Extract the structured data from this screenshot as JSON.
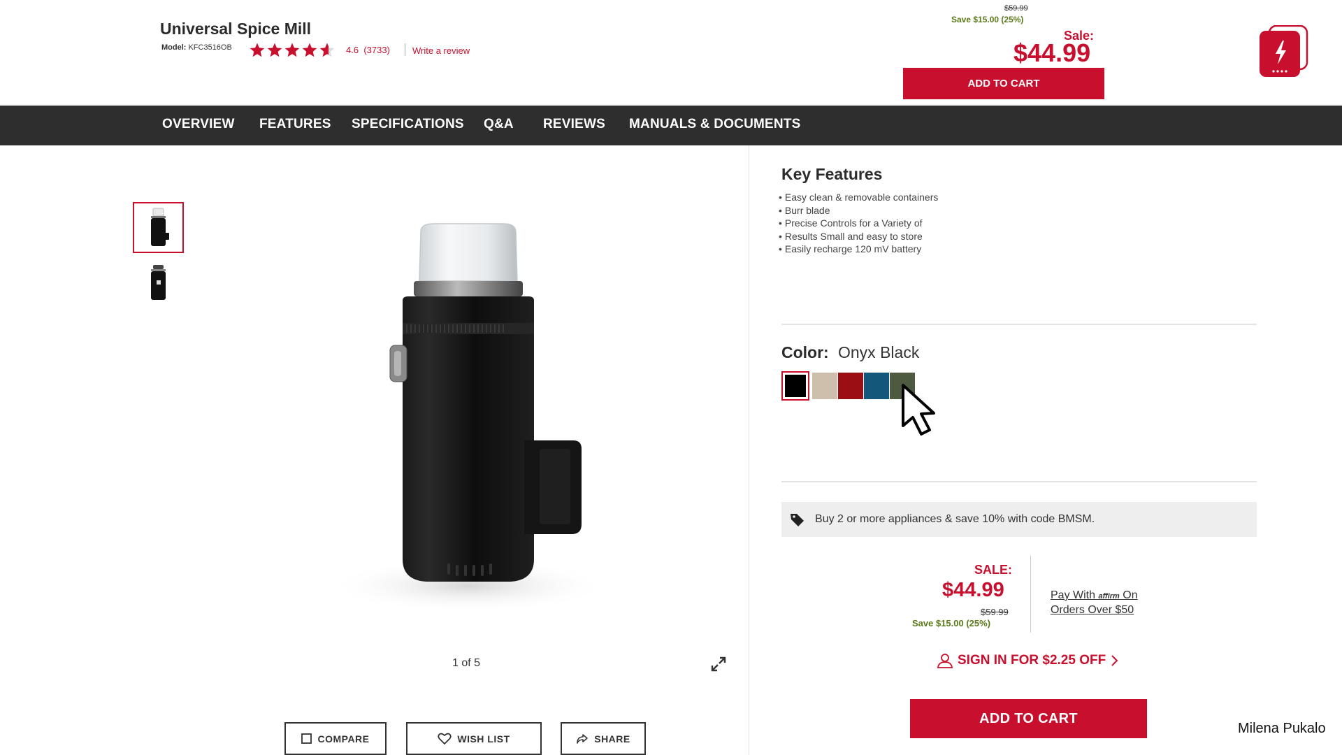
{
  "product": {
    "title": "Universal Spice Mill",
    "model_label": "Model:",
    "model_value": "KFC3516OB",
    "rating": 4.6,
    "rating_text": "4.6",
    "review_count": "(3733)",
    "write_review": "Write a review"
  },
  "header_price": {
    "original": "$59.99",
    "save": "Save $15.00 (25%)",
    "sale_label": "Sale:",
    "price": "$44.99",
    "add_to_cart": "ADD TO CART"
  },
  "nav": {
    "items": [
      "OVERVIEW",
      "FEATURES",
      "SPECIFICATIONS",
      "Q&A",
      "REVIEWS",
      "MANUALS & DOCUMENTS"
    ]
  },
  "gallery": {
    "pager": "1 of 5",
    "actions": {
      "compare": "COMPARE",
      "wish_list": "WISH LIST",
      "share": "SHARE"
    }
  },
  "key_features": {
    "title": "Key Features",
    "items": [
      "Easy clean & removable containers",
      "Burr blade",
      "Precise Controls for a Variety of",
      "Results Small and easy to store",
      "Easily recharge 120 mV battery"
    ]
  },
  "color": {
    "label": "Color:",
    "selected": "Onyx Black",
    "swatches": [
      "#000000",
      "#cdbfac",
      "#9b0e14",
      "#13587a",
      "#4e5a3f"
    ]
  },
  "promo": {
    "text": "Buy 2 or more appliances & save 10% with code BMSM."
  },
  "price_box": {
    "sale_label": "SALE:",
    "price": "$44.99",
    "original": "$59.99",
    "save": "Save $15.00 (25%)",
    "affirm_line1_a": "Pay With ",
    "affirm_brand": "affirm",
    "affirm_line1_b": " On",
    "affirm_line2": "Orders Over $50"
  },
  "signin": {
    "text": "SIGN IN FOR $2.25 OFF"
  },
  "cta": {
    "add_to_cart": "ADD TO CART"
  },
  "credit": {
    "author": "Milena Pukalo"
  },
  "colors": {
    "brand_red": "#c8102e",
    "nav_bg": "#2e2e2e",
    "save_green": "#5a7a18"
  }
}
